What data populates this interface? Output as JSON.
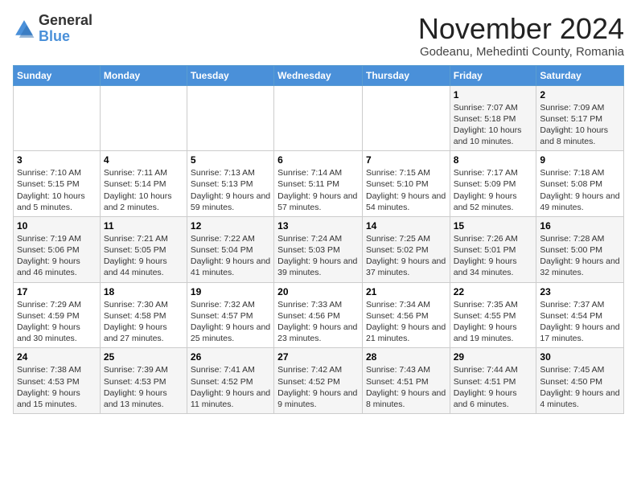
{
  "logo": {
    "general": "General",
    "blue": "Blue"
  },
  "title": "November 2024",
  "subtitle": "Godeanu, Mehedinti County, Romania",
  "header": {
    "days": [
      "Sunday",
      "Monday",
      "Tuesday",
      "Wednesday",
      "Thursday",
      "Friday",
      "Saturday"
    ]
  },
  "weeks": [
    [
      {
        "day": "",
        "info": ""
      },
      {
        "day": "",
        "info": ""
      },
      {
        "day": "",
        "info": ""
      },
      {
        "day": "",
        "info": ""
      },
      {
        "day": "",
        "info": ""
      },
      {
        "day": "1",
        "info": "Sunrise: 7:07 AM\nSunset: 5:18 PM\nDaylight: 10 hours and 10 minutes."
      },
      {
        "day": "2",
        "info": "Sunrise: 7:09 AM\nSunset: 5:17 PM\nDaylight: 10 hours and 8 minutes."
      }
    ],
    [
      {
        "day": "3",
        "info": "Sunrise: 7:10 AM\nSunset: 5:15 PM\nDaylight: 10 hours and 5 minutes."
      },
      {
        "day": "4",
        "info": "Sunrise: 7:11 AM\nSunset: 5:14 PM\nDaylight: 10 hours and 2 minutes."
      },
      {
        "day": "5",
        "info": "Sunrise: 7:13 AM\nSunset: 5:13 PM\nDaylight: 9 hours and 59 minutes."
      },
      {
        "day": "6",
        "info": "Sunrise: 7:14 AM\nSunset: 5:11 PM\nDaylight: 9 hours and 57 minutes."
      },
      {
        "day": "7",
        "info": "Sunrise: 7:15 AM\nSunset: 5:10 PM\nDaylight: 9 hours and 54 minutes."
      },
      {
        "day": "8",
        "info": "Sunrise: 7:17 AM\nSunset: 5:09 PM\nDaylight: 9 hours and 52 minutes."
      },
      {
        "day": "9",
        "info": "Sunrise: 7:18 AM\nSunset: 5:08 PM\nDaylight: 9 hours and 49 minutes."
      }
    ],
    [
      {
        "day": "10",
        "info": "Sunrise: 7:19 AM\nSunset: 5:06 PM\nDaylight: 9 hours and 46 minutes."
      },
      {
        "day": "11",
        "info": "Sunrise: 7:21 AM\nSunset: 5:05 PM\nDaylight: 9 hours and 44 minutes."
      },
      {
        "day": "12",
        "info": "Sunrise: 7:22 AM\nSunset: 5:04 PM\nDaylight: 9 hours and 41 minutes."
      },
      {
        "day": "13",
        "info": "Sunrise: 7:24 AM\nSunset: 5:03 PM\nDaylight: 9 hours and 39 minutes."
      },
      {
        "day": "14",
        "info": "Sunrise: 7:25 AM\nSunset: 5:02 PM\nDaylight: 9 hours and 37 minutes."
      },
      {
        "day": "15",
        "info": "Sunrise: 7:26 AM\nSunset: 5:01 PM\nDaylight: 9 hours and 34 minutes."
      },
      {
        "day": "16",
        "info": "Sunrise: 7:28 AM\nSunset: 5:00 PM\nDaylight: 9 hours and 32 minutes."
      }
    ],
    [
      {
        "day": "17",
        "info": "Sunrise: 7:29 AM\nSunset: 4:59 PM\nDaylight: 9 hours and 30 minutes."
      },
      {
        "day": "18",
        "info": "Sunrise: 7:30 AM\nSunset: 4:58 PM\nDaylight: 9 hours and 27 minutes."
      },
      {
        "day": "19",
        "info": "Sunrise: 7:32 AM\nSunset: 4:57 PM\nDaylight: 9 hours and 25 minutes."
      },
      {
        "day": "20",
        "info": "Sunrise: 7:33 AM\nSunset: 4:56 PM\nDaylight: 9 hours and 23 minutes."
      },
      {
        "day": "21",
        "info": "Sunrise: 7:34 AM\nSunset: 4:56 PM\nDaylight: 9 hours and 21 minutes."
      },
      {
        "day": "22",
        "info": "Sunrise: 7:35 AM\nSunset: 4:55 PM\nDaylight: 9 hours and 19 minutes."
      },
      {
        "day": "23",
        "info": "Sunrise: 7:37 AM\nSunset: 4:54 PM\nDaylight: 9 hours and 17 minutes."
      }
    ],
    [
      {
        "day": "24",
        "info": "Sunrise: 7:38 AM\nSunset: 4:53 PM\nDaylight: 9 hours and 15 minutes."
      },
      {
        "day": "25",
        "info": "Sunrise: 7:39 AM\nSunset: 4:53 PM\nDaylight: 9 hours and 13 minutes."
      },
      {
        "day": "26",
        "info": "Sunrise: 7:41 AM\nSunset: 4:52 PM\nDaylight: 9 hours and 11 minutes."
      },
      {
        "day": "27",
        "info": "Sunrise: 7:42 AM\nSunset: 4:52 PM\nDaylight: 9 hours and 9 minutes."
      },
      {
        "day": "28",
        "info": "Sunrise: 7:43 AM\nSunset: 4:51 PM\nDaylight: 9 hours and 8 minutes."
      },
      {
        "day": "29",
        "info": "Sunrise: 7:44 AM\nSunset: 4:51 PM\nDaylight: 9 hours and 6 minutes."
      },
      {
        "day": "30",
        "info": "Sunrise: 7:45 AM\nSunset: 4:50 PM\nDaylight: 9 hours and 4 minutes."
      }
    ]
  ]
}
